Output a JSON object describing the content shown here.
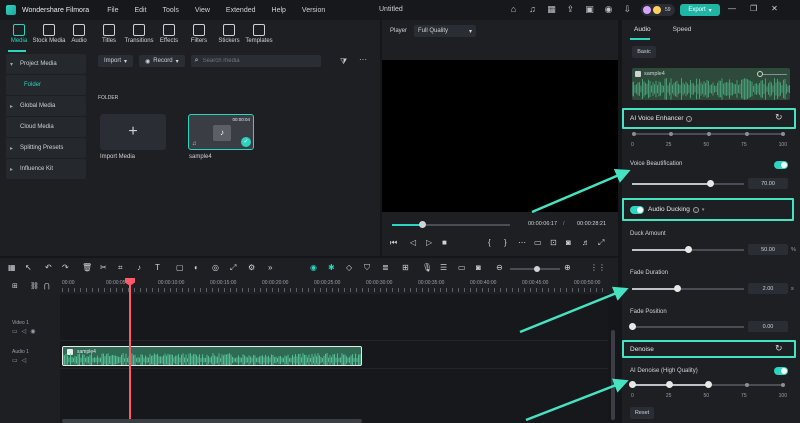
{
  "window": {
    "app_name": "Wondershare Filmora",
    "doc_title": "Untitled",
    "menu": [
      "File",
      "Edit",
      "Tools",
      "View",
      "Extended",
      "Help",
      "Version"
    ],
    "user_count": "59",
    "export_label": "Export"
  },
  "media": {
    "tabs": [
      {
        "label": "Media",
        "icon": "media-icon"
      },
      {
        "label": "Stock Media",
        "icon": "cloud-download-icon"
      },
      {
        "label": "Audio",
        "icon": "music-note-icon"
      },
      {
        "label": "Titles",
        "icon": "text-icon"
      },
      {
        "label": "Transitions",
        "icon": "transition-icon"
      },
      {
        "label": "Effects",
        "icon": "sparkle-icon"
      },
      {
        "label": "Filters",
        "icon": "filter-icon"
      },
      {
        "label": "Stickers",
        "icon": "sticker-icon"
      },
      {
        "label": "Templates",
        "icon": "template-icon"
      }
    ],
    "nav": [
      {
        "label": "Project Media",
        "chevron": "▾"
      },
      {
        "label": "Folder"
      },
      {
        "label": "Global Media",
        "chevron": "▸"
      },
      {
        "label": "Cloud Media"
      },
      {
        "label": "Splitting Presets",
        "chevron": "▸"
      },
      {
        "label": "Influence Kit",
        "chevron": "▸"
      }
    ],
    "import_label": "Import",
    "record_label": "Record",
    "search_placeholder": "Search media",
    "folder_heading": "FOLDER",
    "import_card_label": "Import Media",
    "clip": {
      "name": "sample4",
      "duration": "00:00:04"
    }
  },
  "player": {
    "label": "Player",
    "quality": "Full Quality",
    "progress": 0.25,
    "current_time": "00:00:06:17",
    "separator": "/",
    "total_time": "00:00:28:21"
  },
  "right_panel": {
    "tabs": [
      "Audio",
      "Speed"
    ],
    "basic_label": "Basic",
    "audio_name": "sample4",
    "ai_voice_enhancer": {
      "title": "AI Voice Enhancer",
      "ticks": [
        "0",
        "25",
        "50",
        "75",
        "100"
      ],
      "value": 0
    },
    "voice_beautification": {
      "label": "Voice Beautification",
      "value": "70.00",
      "level": 0.7,
      "enabled": true
    },
    "audio_ducking": {
      "title": "Audio Ducking",
      "enabled": true
    },
    "duck_amount": {
      "label": "Duck Amount",
      "value": "50.00",
      "unit": "%",
      "level": 0.5
    },
    "fade_duration": {
      "label": "Fade Duration",
      "value": "2.00",
      "unit": "s",
      "level": 0.4
    },
    "fade_position": {
      "label": "Fade Position",
      "value": "0.00",
      "level": 0.0
    },
    "denoise": {
      "title": "Denoise"
    },
    "ai_denoise": {
      "label": "AI Denoise (High Quality)",
      "enabled": true,
      "ticks": [
        "0",
        "25",
        "50",
        "75",
        "100"
      ],
      "level": 0.5
    },
    "reset_label": "Reset"
  },
  "timeline": {
    "ruler": [
      "00:00",
      "00:00:05:00",
      "00:00:10:00",
      "00:00:15:00",
      "00:00:20:00",
      "00:00:25:00",
      "00:00:30:00",
      "00:00:35:00",
      "00:00:40:00",
      "00:00:45:00",
      "00:00:50:00"
    ],
    "tracks": [
      {
        "name": "Video 1"
      },
      {
        "name": "Audio 1"
      }
    ],
    "clip_name": "sample4"
  },
  "colors": {
    "accent": "#2dd4bf",
    "highlight": "#46e3c2",
    "playhead": "#ff5a6a"
  }
}
